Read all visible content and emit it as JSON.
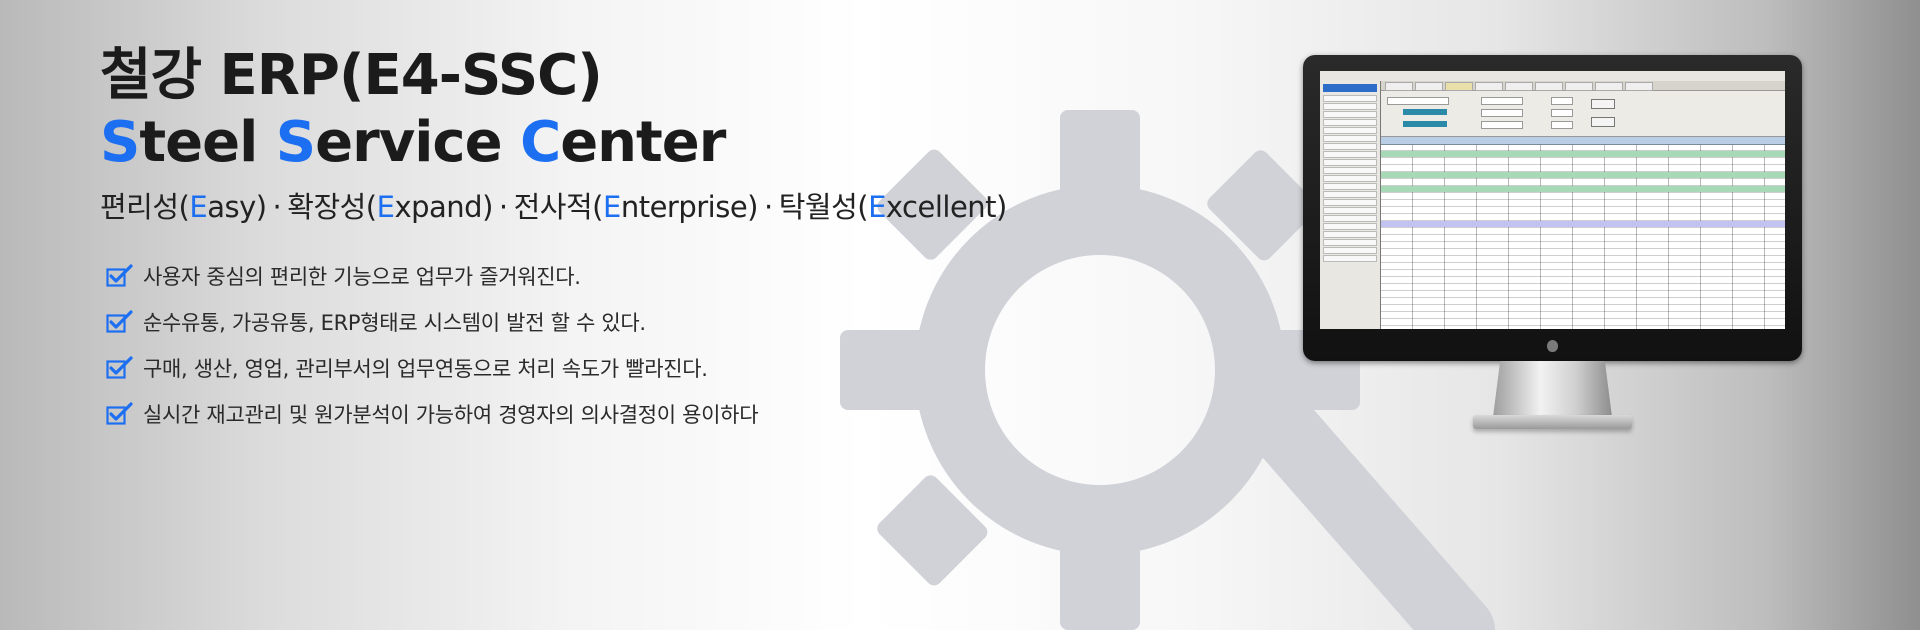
{
  "hero": {
    "title_line1": "철강 ERP(E4-SSC)",
    "title_line2": [
      {
        "accent": "S",
        "rest": "teel "
      },
      {
        "accent": "S",
        "rest": "ervice "
      },
      {
        "accent": "C",
        "rest": "enter"
      }
    ],
    "subtitle": [
      {
        "pre": "편리성(",
        "accent": "E",
        "post": "asy)"
      },
      {
        "pre": "확장성(",
        "accent": "E",
        "post": "xpand)"
      },
      {
        "pre": "전사적(",
        "accent": "E",
        "post": "nterprise)"
      },
      {
        "pre": "탁월성(",
        "accent": "E",
        "post": "xcellent)"
      }
    ],
    "separator": "·"
  },
  "features": [
    "사용자 중심의 편리한 기능으로 업무가 즐거워진다.",
    "순수유통, 가공유통, ERP형태로 시스템이 발전 할 수 있다.",
    "구매, 생산, 영업, 관리부서의 업무연동으로 처리 속도가 빨라진다.",
    "실시간 재고관리 및 원가분석이 가능하여 경영자의 의사결정이 용이하다"
  ],
  "colors": {
    "accent": "#1d6ff2",
    "check_icon": "#1d6ff2",
    "gear": "#d0d2d8",
    "title_text": "#1b1b1b"
  },
  "icons": {
    "feature_bullet": "checkbox-check-icon",
    "background": "gear-icon",
    "monitor_logo": "apple-logo-icon"
  }
}
